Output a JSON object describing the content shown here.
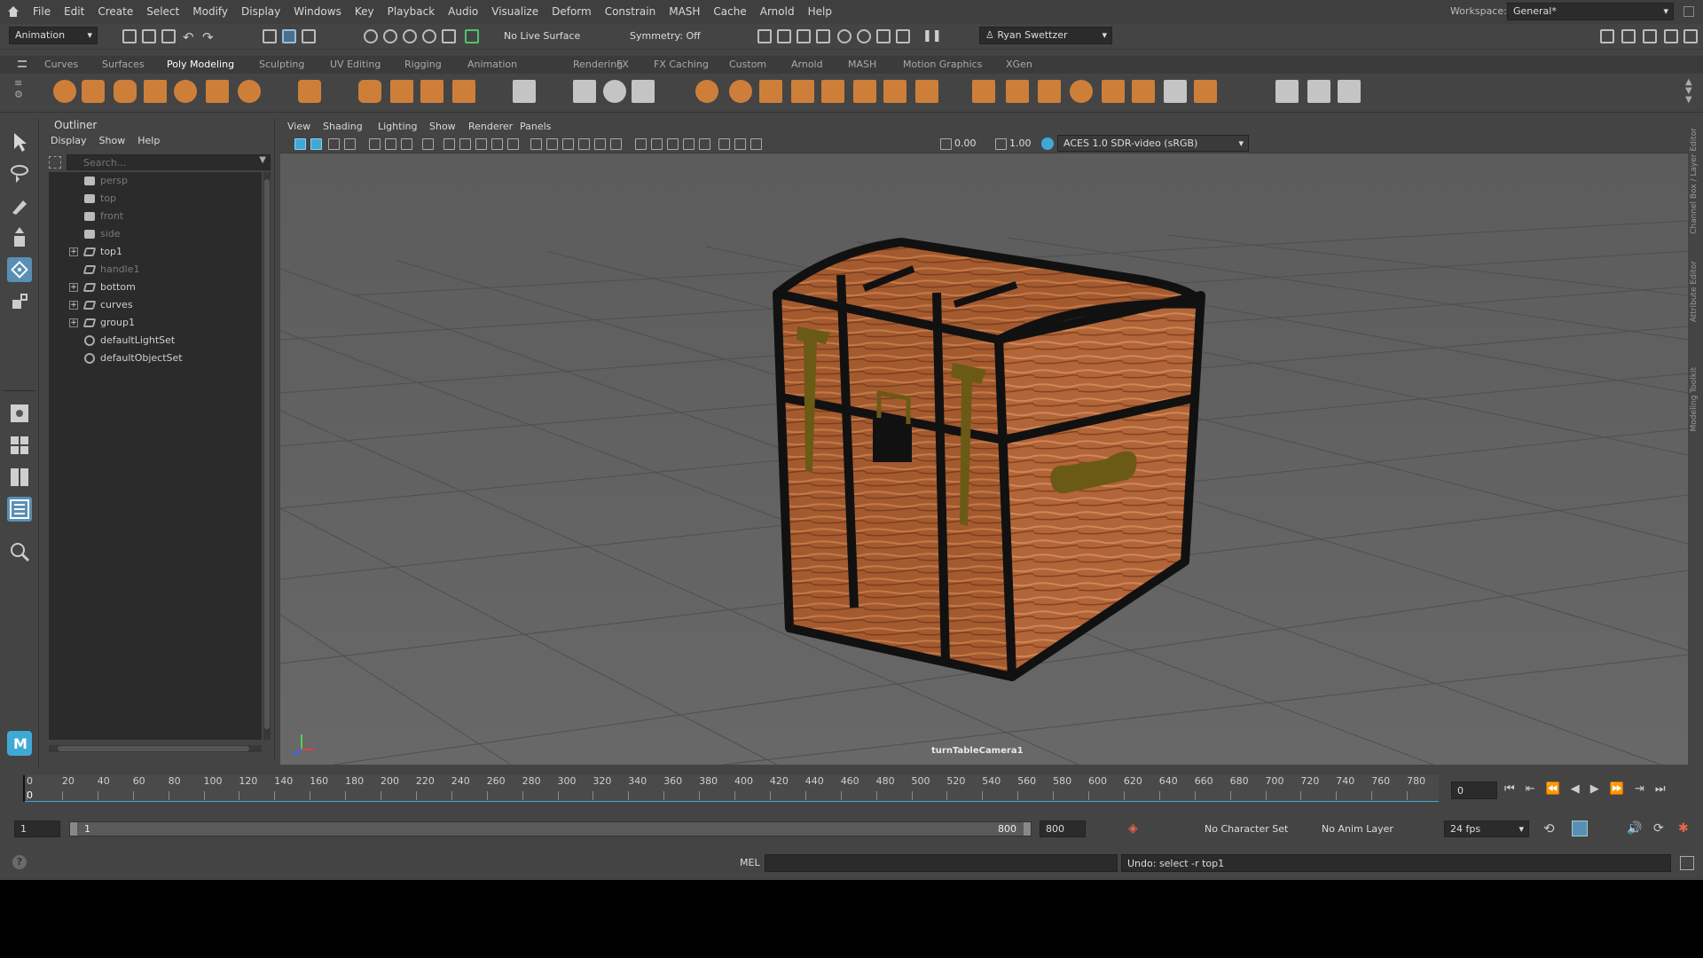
{
  "menubar": {
    "items": [
      "File",
      "Edit",
      "Create",
      "Select",
      "Modify",
      "Display",
      "Windows",
      "Key",
      "Playback",
      "Audio",
      "Visualize",
      "Deform",
      "Constrain",
      "MASH",
      "Cache",
      "Arnold",
      "Help"
    ],
    "workspace_label": "Workspace:",
    "workspace_value": "General*"
  },
  "statusline": {
    "mode": "Animation",
    "live_surface": "No Live Surface",
    "symmetry": "Symmetry: Off",
    "user": "Ryan Swettzer"
  },
  "shelf": {
    "tabs": [
      "Curves",
      "Surfaces",
      "Poly Modeling",
      "Sculpting",
      "UV Editing",
      "Rigging",
      "Animation",
      "Rendering",
      "FX",
      "FX Caching",
      "Custom",
      "Arnold",
      "MASH",
      "Motion Graphics",
      "XGen"
    ],
    "active_tab": "Poly Modeling"
  },
  "outliner": {
    "title": "Outliner",
    "menu": [
      "Display",
      "Show",
      "Help"
    ],
    "search_placeholder": "Search...",
    "items": [
      {
        "label": "persp",
        "icon": "camera-icon",
        "dim": true,
        "expandable": false
      },
      {
        "label": "top",
        "icon": "camera-icon",
        "dim": true,
        "expandable": false
      },
      {
        "label": "front",
        "icon": "camera-icon",
        "dim": true,
        "expandable": false
      },
      {
        "label": "side",
        "icon": "camera-icon",
        "dim": true,
        "expandable": false
      },
      {
        "label": "top1",
        "icon": "transform-icon",
        "dim": false,
        "expandable": true
      },
      {
        "label": "handle1",
        "icon": "transform-icon",
        "dim": true,
        "expandable": false
      },
      {
        "label": "bottom",
        "icon": "transform-icon",
        "dim": false,
        "expandable": true
      },
      {
        "label": "curves",
        "icon": "transform-icon",
        "dim": false,
        "expandable": true
      },
      {
        "label": "group1",
        "icon": "transform-icon",
        "dim": false,
        "expandable": true
      },
      {
        "label": "defaultLightSet",
        "icon": "set-icon",
        "dim": false,
        "expandable": false
      },
      {
        "label": "defaultObjectSet",
        "icon": "set-icon",
        "dim": false,
        "expandable": false
      }
    ]
  },
  "viewport": {
    "menu": [
      "View",
      "Shading",
      "Lighting",
      "Show",
      "Renderer",
      "Panels"
    ],
    "exposure": "0.00",
    "gamma": "1.00",
    "colorspace": "ACES 1.0 SDR-video (sRGB)",
    "camera_label": "turnTableCamera1"
  },
  "side_tabs": [
    "Channel Box / Layer Editor",
    "Attribute Editor",
    "Modeling Toolkit"
  ],
  "timeline": {
    "ticks": [
      "0",
      "20",
      "40",
      "60",
      "80",
      "100",
      "120",
      "140",
      "160",
      "180",
      "200",
      "220",
      "240",
      "260",
      "280",
      "300",
      "320",
      "340",
      "360",
      "380",
      "400",
      "420",
      "440",
      "460",
      "480",
      "500",
      "520",
      "540",
      "560",
      "580",
      "600",
      "620",
      "640",
      "660",
      "680",
      "700",
      "720",
      "740",
      "760",
      "780"
    ],
    "current_frame_marker": "0",
    "current_frame": "0"
  },
  "range": {
    "start": "1",
    "inner_start": "1",
    "inner_end": "800",
    "end": "800",
    "character_set": "No Character Set",
    "anim_layer": "No Anim Layer",
    "fps": "24 fps"
  },
  "cmdline": {
    "lang": "MEL",
    "feedback": "Undo: select -r top1"
  },
  "colors": {
    "chest_wood": "#a45a2f",
    "chest_band": "#111111",
    "chest_brass": "#6b5a16",
    "accent_blue": "#3fa9d6",
    "active_tool": "#5a8fb4"
  }
}
